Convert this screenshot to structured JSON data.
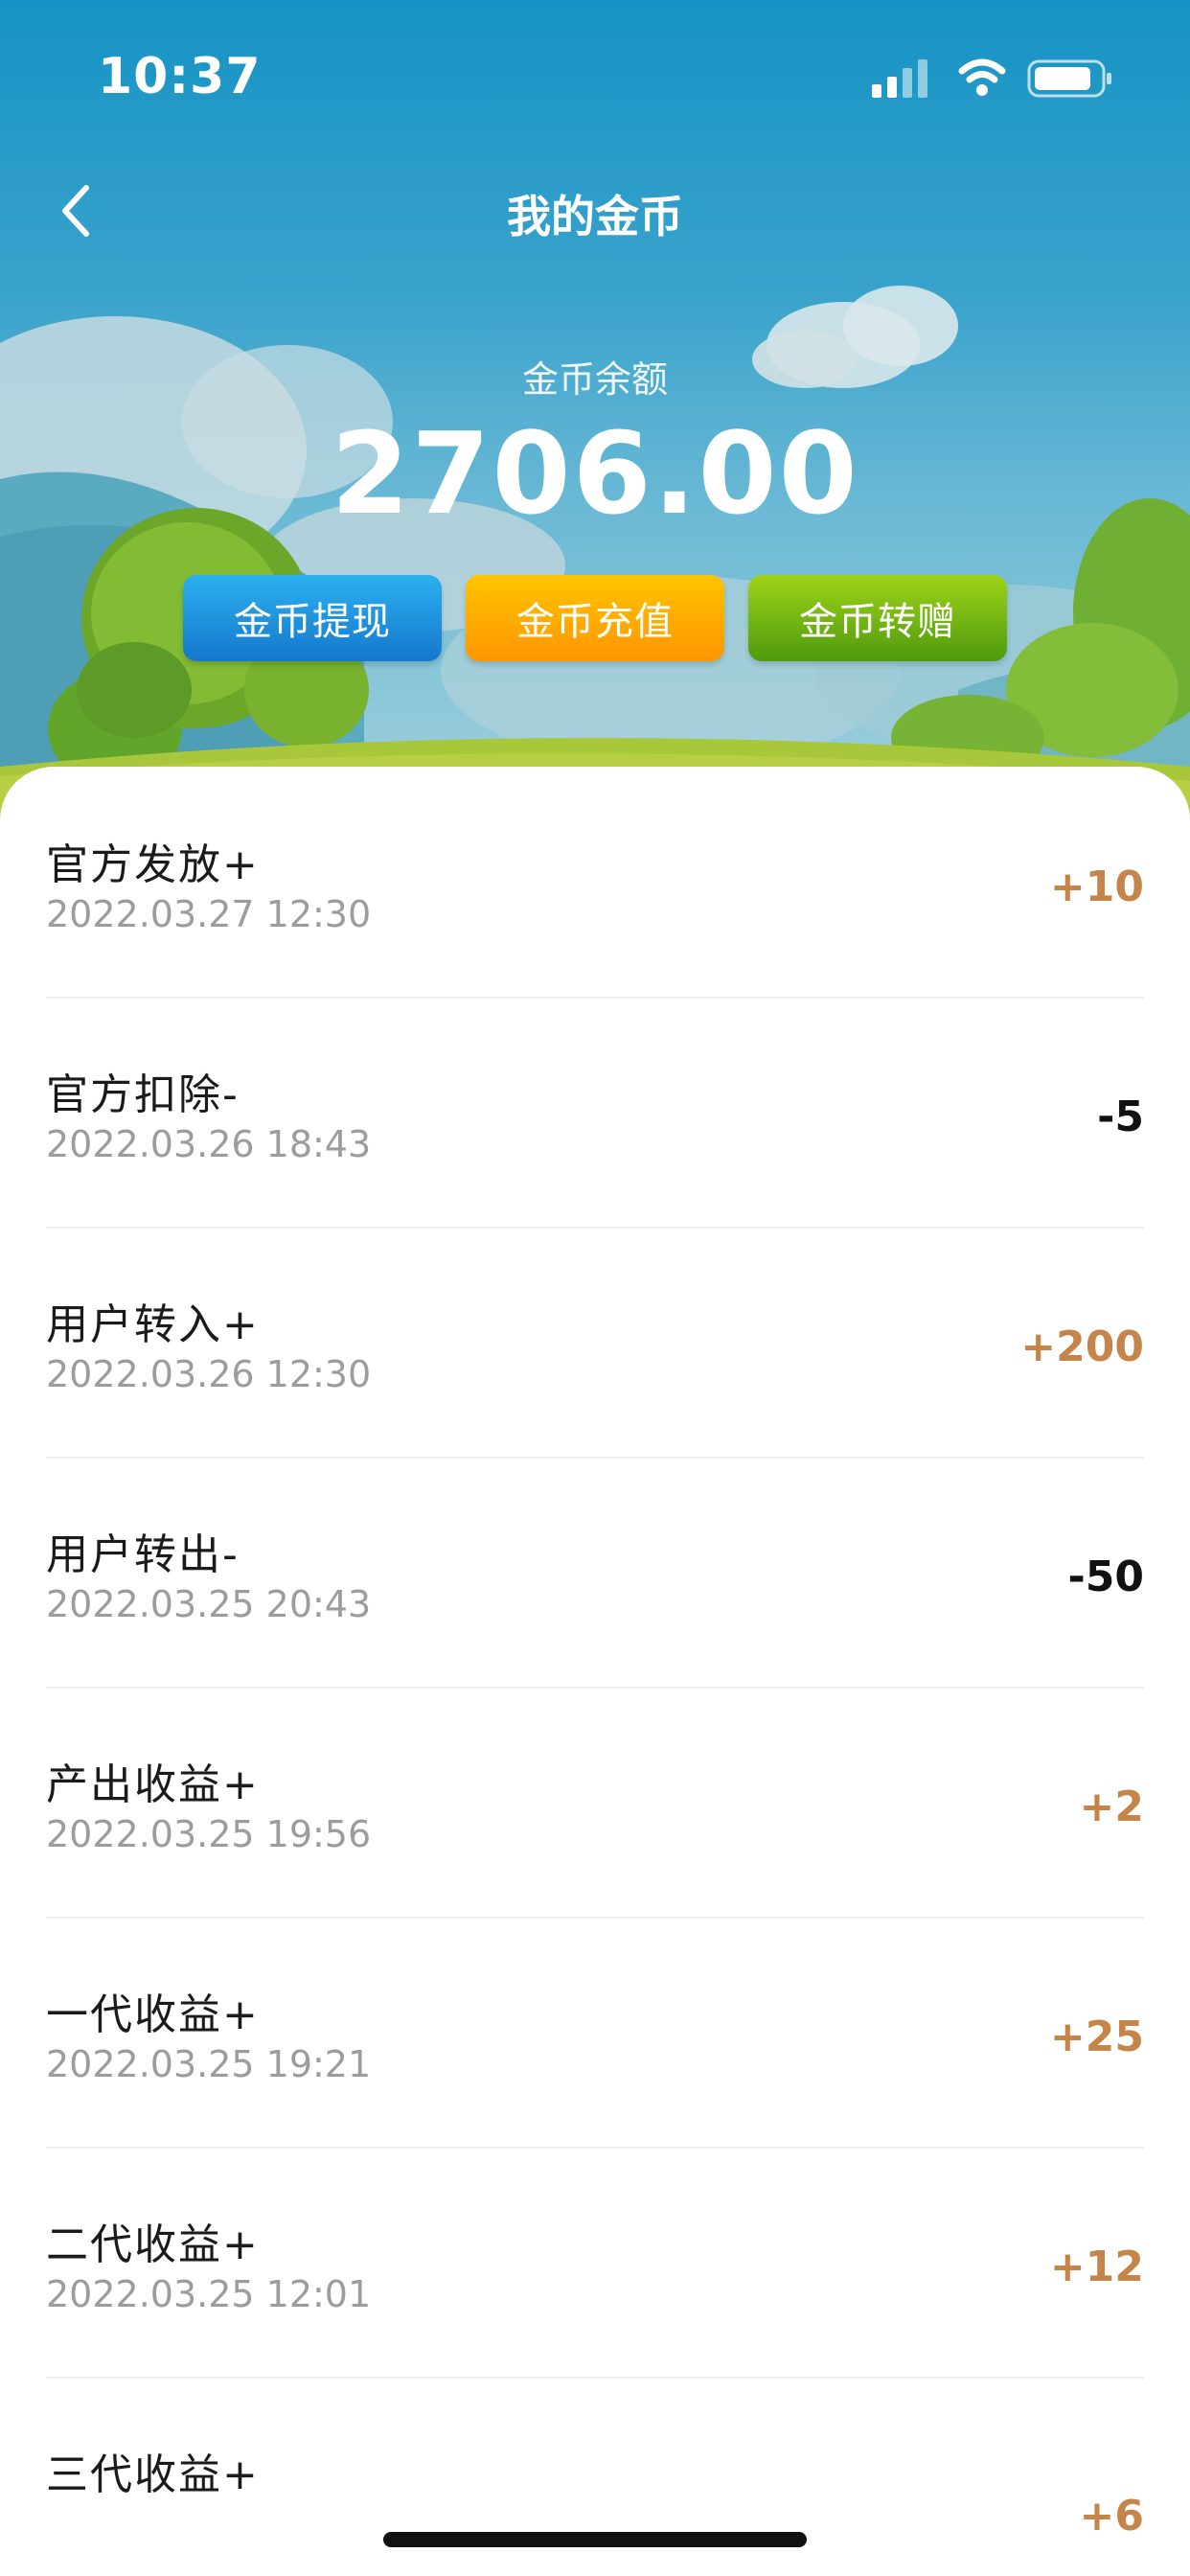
{
  "status_bar": {
    "time": "10:37"
  },
  "nav": {
    "title": "我的金币",
    "back_icon": "chevron-left-icon"
  },
  "balance": {
    "label": "金币余额",
    "value": "2706.00"
  },
  "actions": [
    {
      "label": "金币提现",
      "color": "#1e8fe0"
    },
    {
      "label": "金币充值",
      "color": "#ffae00"
    },
    {
      "label": "金币转赠",
      "color": "#74b515"
    }
  ],
  "records": [
    {
      "title": "官方发放+",
      "time": "2022.03.27 12:30",
      "amount": "+10",
      "type": "plus"
    },
    {
      "title": "官方扣除-",
      "time": "2022.03.26 18:43",
      "amount": "-5",
      "type": "minus"
    },
    {
      "title": "用户转入+",
      "time": "2022.03.26 12:30",
      "amount": "+200",
      "type": "plus"
    },
    {
      "title": "用户转出-",
      "time": "2022.03.25 20:43",
      "amount": "-50",
      "type": "minus"
    },
    {
      "title": "产出收益+",
      "time": "2022.03.25 19:56",
      "amount": "+2",
      "type": "plus"
    },
    {
      "title": "一代收益+",
      "time": "2022.03.25 19:21",
      "amount": "+25",
      "type": "plus"
    },
    {
      "title": "二代收益+",
      "time": "2022.03.25 12:01",
      "amount": "+12",
      "type": "plus"
    },
    {
      "title": "三代收益+",
      "time": "",
      "amount": "+6",
      "type": "plus"
    }
  ],
  "colors": {
    "plus_amount": "#c5854a",
    "minus_amount": "#111111",
    "hero_top": "#1593c4"
  }
}
